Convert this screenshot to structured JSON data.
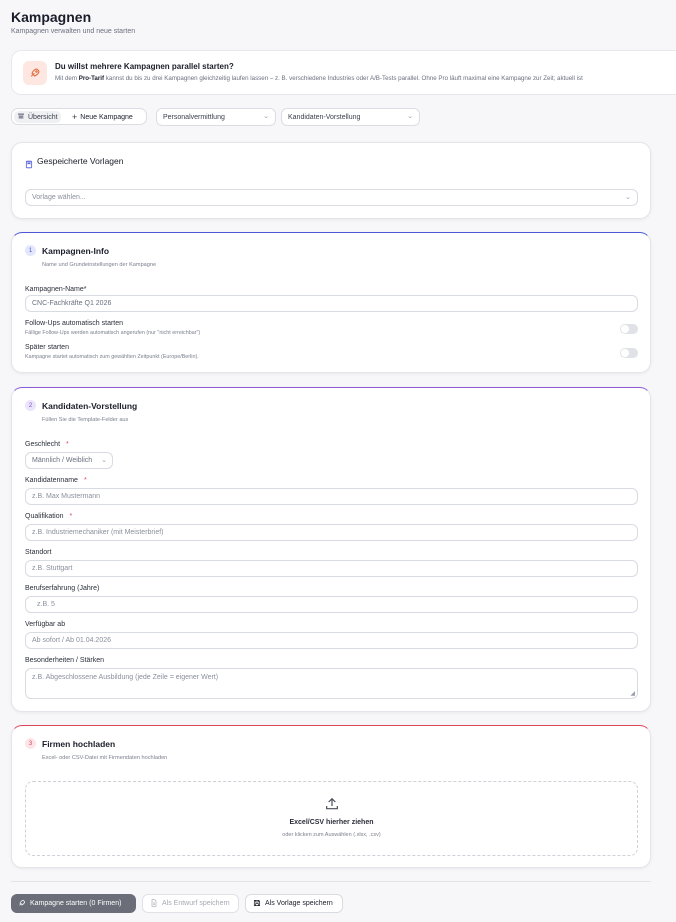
{
  "header": {
    "title": "Kampagnen",
    "subtitle": "Kampagnen verwalten und neue starten"
  },
  "promo": {
    "icon": "rocket-icon",
    "title": "Du willst mehrere Kampagnen parallel starten?",
    "text_before": "Mit dem ",
    "text_bold": "Pro-Tarif",
    "text_after": " kannst du bis zu drei Kampagnen gleichzeitig laufen lassen – z. B. verschiedene Industries oder A/B-Tests parallel. Ohne Pro läuft maximal eine Kampagne zur Zeit; aktuell ist"
  },
  "toolbar": {
    "tab_overview": "Übersicht",
    "tab_new": "Neue Kampagne",
    "select_industry": "Personalvermittlung",
    "select_template": "Kandidaten-Vorstellung"
  },
  "templates": {
    "title": "Gespeicherte Vorlagen",
    "placeholder": "Vorlage wählen..."
  },
  "section1": {
    "num": "1",
    "title": "Kampagnen-Info",
    "subtitle": "Name und Grundeinstellungen der Kampagne",
    "name_label": "Kampagnen-Name",
    "name_required": "*",
    "name_value": "CNC-Fachkräfte Q1 2026",
    "followup_label": "Follow-Ups automatisch starten",
    "followup_hint": "Fällige Follow-Ups werden automatisch angerufen (nur \"nicht erreichbar\")",
    "later_label": "Später starten",
    "later_hint": "Kampagne startet automatisch zum gewählten Zeitpunkt (Europe/Berlin)."
  },
  "section2": {
    "num": "2",
    "title": "Kandidaten-Vorstellung",
    "subtitle": "Füllen Sie die Template-Felder aus",
    "gender_label": "Geschlecht",
    "gender_value": "Männlich / Weiblich",
    "name_label": "Kandidatenname",
    "name_placeholder": "z.B. Max Mustermann",
    "qual_label": "Qualifikation",
    "qual_placeholder": "z.B. Industriemechaniker (mit Meisterbrief)",
    "location_label": "Standort",
    "location_placeholder": "z.B. Stuttgart",
    "exp_label": "Berufserfahrung (Jahre)",
    "exp_placeholder": "z.B. 5",
    "avail_label": "Verfügbar ab",
    "avail_placeholder": "Ab sofort / Ab 01.04.2026",
    "special_label": "Besonderheiten / Stärken",
    "special_placeholder": "z.B. Abgeschlossene Ausbildung (jede Zeile = eigener Wert)",
    "required": "*"
  },
  "section3": {
    "num": "3",
    "title": "Firmen hochladen",
    "subtitle": "Excel- oder CSV-Datei mit Firmendaten hochladen",
    "drop_title": "Excel/CSV hierher ziehen",
    "drop_sub": "oder klicken zum Auswählen (.xlsx, .csv)"
  },
  "footer": {
    "start": "Kampagne starten (0 Firmen)",
    "draft": "Als Entwurf speichern",
    "template": "Als Vorlage speichern"
  },
  "colors": {
    "accent_blue": "#4b57d6",
    "accent_purple": "#8d5ad8",
    "accent_red": "#e0465a"
  }
}
